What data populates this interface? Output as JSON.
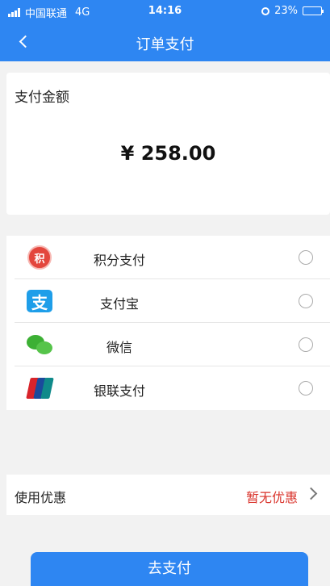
{
  "status_bar": {
    "carrier": "中国联通",
    "network": "4G",
    "time": "14:16",
    "battery": "23%",
    "battery_level": 0.23
  },
  "nav": {
    "title": "订单支付",
    "back_icon": "chevron-left-icon"
  },
  "amount": {
    "label": "支付金额",
    "value": "¥ 258.00"
  },
  "payment_methods": [
    {
      "label": "积分支付",
      "icon": "points-icon",
      "icon_text": "积",
      "color": "#e3463d"
    },
    {
      "label": "支付宝",
      "icon": "alipay-icon",
      "icon_text": "支",
      "color": "#1e9ee9"
    },
    {
      "label": "微信",
      "icon": "wechat-icon",
      "color": "#3cb034"
    },
    {
      "label": "银联支付",
      "icon": "unionpay-icon",
      "colors": [
        "#d8232a",
        "#1a4a9c",
        "#0f8a8a"
      ]
    }
  ],
  "discount": {
    "label": "使用优惠",
    "value": "暂无优惠",
    "value_color": "#d9322a"
  },
  "submit": {
    "label": "去支付"
  },
  "colors": {
    "primary": "#2e86f2",
    "background": "#f2f2f2"
  }
}
